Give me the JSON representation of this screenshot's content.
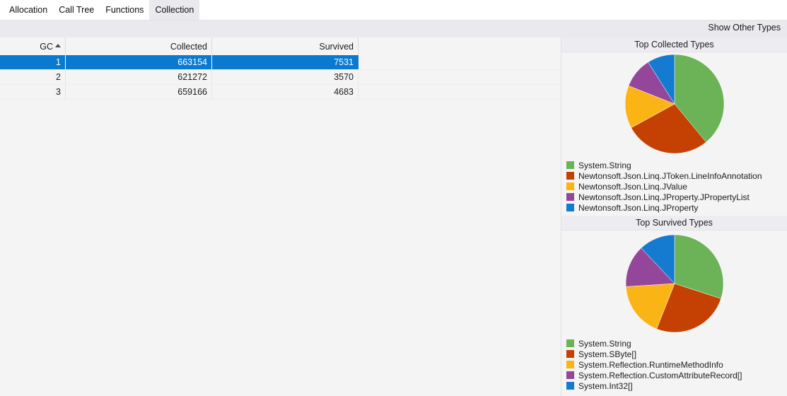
{
  "tabs": [
    {
      "label": "Allocation",
      "selected": false
    },
    {
      "label": "Call Tree",
      "selected": false
    },
    {
      "label": "Functions",
      "selected": false
    },
    {
      "label": "Collection",
      "selected": true
    }
  ],
  "toolbar": {
    "show_other_types_label": "Show Other Types"
  },
  "grid": {
    "columns": [
      {
        "key": "gc",
        "label": "GC",
        "sorted": "asc",
        "sort_glyph": "▲"
      },
      {
        "key": "collected",
        "label": "Collected",
        "sorted": null
      },
      {
        "key": "survived",
        "label": "Survived",
        "sorted": null
      },
      {
        "key": "filler",
        "label": "",
        "sorted": null
      }
    ],
    "rows": [
      {
        "gc": "1",
        "collected": "663154",
        "survived": "7531",
        "selected": true
      },
      {
        "gc": "2",
        "collected": "621272",
        "survived": "3570",
        "selected": false
      },
      {
        "gc": "3",
        "collected": "659166",
        "survived": "4683",
        "selected": false
      }
    ]
  },
  "palette": {
    "green": "#6cb257",
    "orange": "#c44103",
    "amber": "#fbb416",
    "purple": "#94479a",
    "blue": "#147bd1",
    "selection_blue": "#0a7ad1"
  },
  "chart_data": [
    {
      "type": "pie",
      "title": "Top Collected Types",
      "legend_position": "bottom-left",
      "labels": [
        "System.String",
        "Newtonsoft.Json.Linq.JToken.LineInfoAnnotation",
        "Newtonsoft.Json.Linq.JValue",
        "Newtonsoft.Json.Linq.JProperty.JPropertyList",
        "Newtonsoft.Json.Linq.JProperty"
      ],
      "values": [
        39,
        28,
        14,
        10,
        9
      ],
      "colors": [
        "#6cb257",
        "#c44103",
        "#fbb416",
        "#94479a",
        "#147bd1"
      ]
    },
    {
      "type": "pie",
      "title": "Top Survived Types",
      "legend_position": "bottom-left",
      "labels": [
        "System.String",
        "System.SByte[]",
        "System.Reflection.RuntimeMethodInfo",
        "System.Reflection.CustomAttributeRecord[]",
        "System.Int32[]"
      ],
      "values": [
        30,
        26,
        18,
        14,
        12
      ],
      "colors": [
        "#6cb257",
        "#c44103",
        "#fbb416",
        "#94479a",
        "#147bd1"
      ]
    }
  ]
}
